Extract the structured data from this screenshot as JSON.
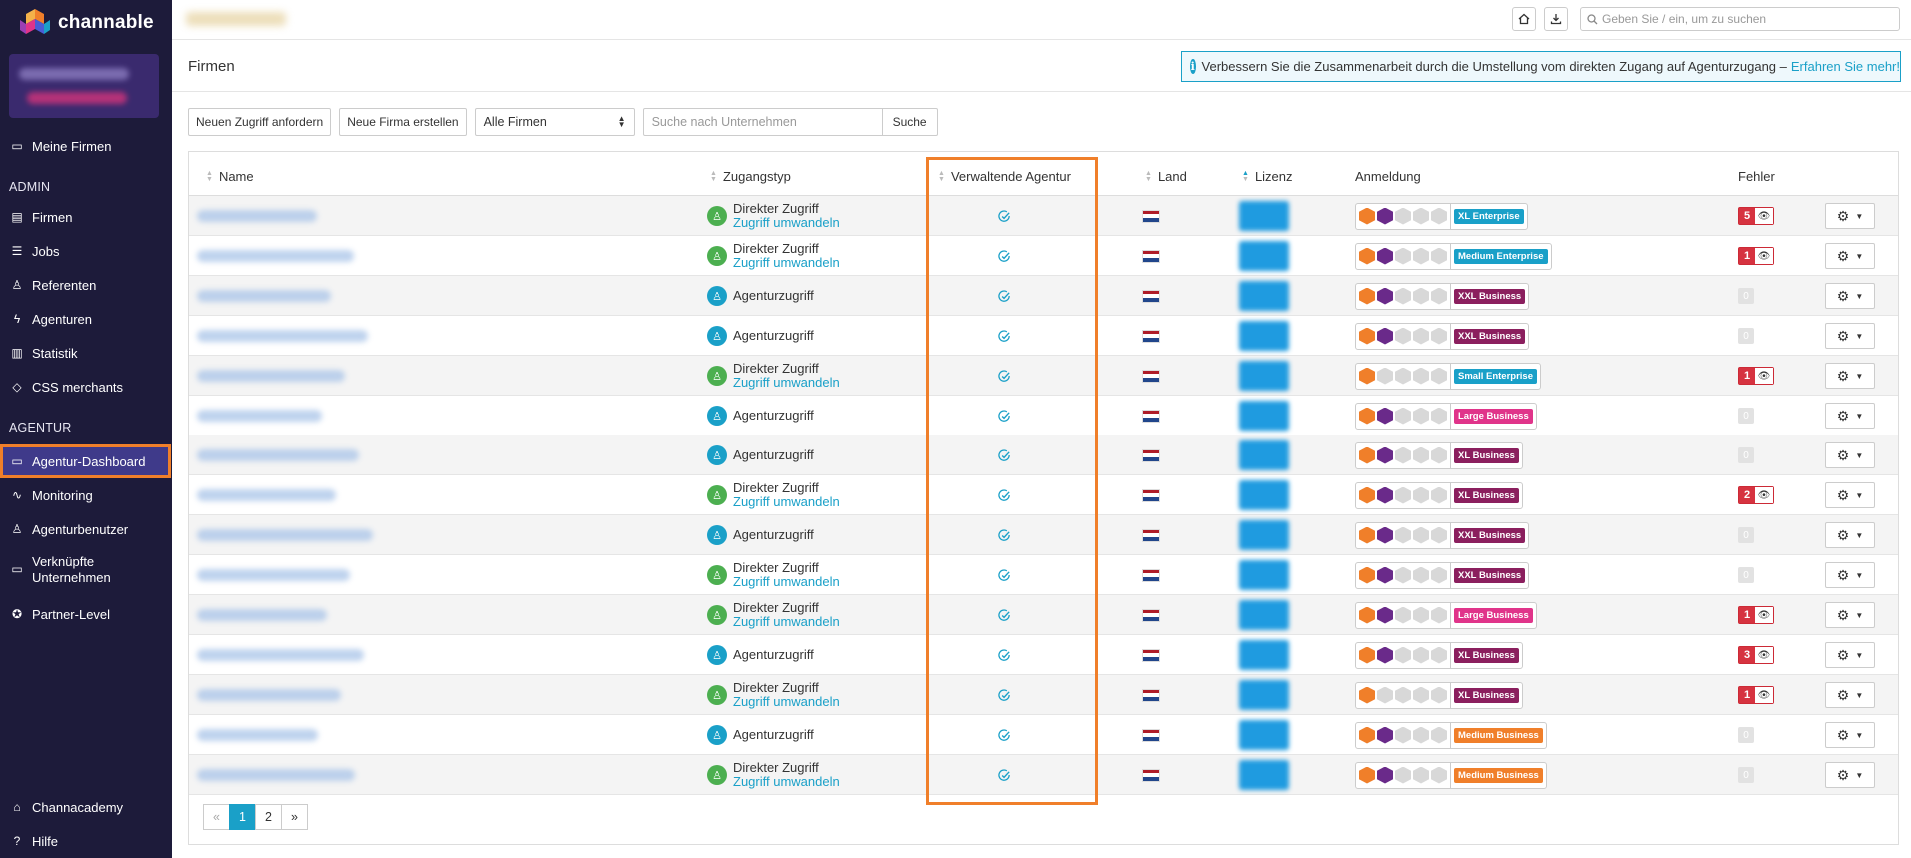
{
  "app": {
    "logo_text": "channable"
  },
  "sidebar": {
    "items": [
      {
        "label": "Meine Firmen",
        "icon": "briefcase-icon",
        "glyph": "▭"
      },
      {
        "label": "Firmen",
        "icon": "building-icon",
        "glyph": "▤"
      },
      {
        "label": "Jobs",
        "icon": "list-icon",
        "glyph": "☰"
      },
      {
        "label": "Referenten",
        "icon": "user-ref-icon",
        "glyph": "♙"
      },
      {
        "label": "Agenturen",
        "icon": "bolt-icon",
        "glyph": "ϟ"
      },
      {
        "label": "Statistik",
        "icon": "bar-chart-icon",
        "glyph": "▥"
      },
      {
        "label": "CSS merchants",
        "icon": "tag-icon",
        "glyph": "◇"
      },
      {
        "label": "Agentur-Dashboard",
        "icon": "monitor-icon",
        "glyph": "▭"
      },
      {
        "label": "Monitoring",
        "icon": "pulse-icon",
        "glyph": "∿"
      },
      {
        "label": "Agenturbenutzer",
        "icon": "users-icon",
        "glyph": "♙"
      },
      {
        "label_line1": "Verknüpfte",
        "label_line2": "Unternehmen",
        "icon": "link-briefcase-icon",
        "glyph": "▭"
      },
      {
        "label": "Partner-Level",
        "icon": "award-icon",
        "glyph": "✪"
      },
      {
        "label": "Channacademy",
        "icon": "graduation-icon",
        "glyph": "⌂"
      },
      {
        "label": "Hilfe",
        "icon": "help-icon",
        "glyph": "?"
      }
    ],
    "headings": {
      "admin": "ADMIN",
      "agentur": "AGENTUR"
    }
  },
  "topbar": {
    "search_placeholder": "Geben Sie / ein, um zu suchen"
  },
  "page": {
    "title": "Firmen",
    "banner_text": "Verbessern Sie die Zusammenarbeit durch die Umstellung vom direkten Zugang auf Agenturzugang –",
    "banner_link": "Erfahren Sie mehr!"
  },
  "toolbar": {
    "request_access": "Neuen Zugriff anfordern",
    "new_company": "Neue Firma erstellen",
    "filter_selected": "Alle Firmen",
    "search_placeholder": "Suche nach Unternehmen",
    "search_button": "Suche"
  },
  "table": {
    "headers": {
      "name": "Name",
      "access_type": "Zugangstyp",
      "managing_agency": "Verwaltende Agentur",
      "country": "Land",
      "license": "Lizenz",
      "login": "Anmeldung",
      "errors": "Fehler"
    },
    "direct_label": "Direkter Zugriff",
    "convert_label": "Zugriff umwandeln",
    "agency_label": "Agenturzugriff",
    "rows": [
      {
        "access": "direct",
        "plan": "XL Enterprise",
        "plan_color": "#1aa0c8",
        "errors": "5",
        "hex": [
          "orange",
          "purple",
          "gray",
          "gray",
          "gray"
        ]
      },
      {
        "access": "direct",
        "plan": "Medium Enterprise",
        "plan_color": "#1aa0c8",
        "errors": "1",
        "hex": [
          "orange",
          "purple",
          "gray",
          "gray",
          "gray"
        ]
      },
      {
        "access": "agency",
        "plan": "XXL Business",
        "plan_color": "#8b1f5e",
        "errors": "0",
        "hex": [
          "orange",
          "purple",
          "gray",
          "gray",
          "gray"
        ]
      },
      {
        "access": "agency",
        "plan": "XXL Business",
        "plan_color": "#8b1f5e",
        "errors": "0",
        "hex": [
          "orange",
          "purple",
          "gray",
          "gray",
          "gray"
        ]
      },
      {
        "access": "direct",
        "plan": "Small Enterprise",
        "plan_color": "#1aa0c8",
        "errors": "1",
        "hex": [
          "orange",
          "gray",
          "gray",
          "gray",
          "gray"
        ]
      },
      {
        "access": "agency",
        "plan": "Large Business",
        "plan_color": "#e0348a",
        "errors": "0",
        "hex": [
          "orange",
          "purple",
          "gray",
          "gray",
          "gray"
        ]
      },
      {
        "access": "agency",
        "plan": "XL Business",
        "plan_color": "#8b1f5e",
        "errors": "0",
        "hex": [
          "orange",
          "purple",
          "gray",
          "gray",
          "gray"
        ]
      },
      {
        "access": "direct",
        "plan": "XL Business",
        "plan_color": "#8b1f5e",
        "errors": "2",
        "hex": [
          "orange",
          "purple",
          "gray",
          "gray",
          "gray"
        ]
      },
      {
        "access": "agency",
        "plan": "XXL Business",
        "plan_color": "#8b1f5e",
        "errors": "0",
        "hex": [
          "orange",
          "purple",
          "gray",
          "gray",
          "gray"
        ]
      },
      {
        "access": "direct",
        "plan": "XXL Business",
        "plan_color": "#8b1f5e",
        "errors": "0",
        "hex": [
          "orange",
          "purple",
          "gray",
          "gray",
          "gray"
        ]
      },
      {
        "access": "direct",
        "plan": "Large Business",
        "plan_color": "#e0348a",
        "errors": "1",
        "hex": [
          "orange",
          "purple",
          "gray",
          "gray",
          "gray"
        ]
      },
      {
        "access": "agency",
        "plan": "XL Business",
        "plan_color": "#8b1f5e",
        "errors": "3",
        "hex": [
          "orange",
          "purple",
          "gray",
          "gray",
          "gray"
        ]
      },
      {
        "access": "direct",
        "plan": "XL Business",
        "plan_color": "#8b1f5e",
        "errors": "1",
        "hex": [
          "orange",
          "gray",
          "gray",
          "gray",
          "gray"
        ]
      },
      {
        "access": "agency",
        "plan": "Medium Business",
        "plan_color": "#f07f2a",
        "errors": "0",
        "hex": [
          "orange",
          "purple",
          "gray",
          "gray",
          "gray"
        ]
      },
      {
        "access": "direct",
        "plan": "Medium Business",
        "plan_color": "#f07f2a",
        "errors": "0",
        "hex": [
          "orange",
          "purple",
          "gray",
          "gray",
          "gray"
        ]
      }
    ]
  },
  "pagination": {
    "prev": "«",
    "pages": [
      "1",
      "2"
    ],
    "next": "»",
    "current": "1"
  },
  "colors": {
    "sidebar_bg": "#1d1b3a",
    "accent": "#1aa0c8",
    "highlight": "#f07f2a",
    "error": "#d63340"
  }
}
